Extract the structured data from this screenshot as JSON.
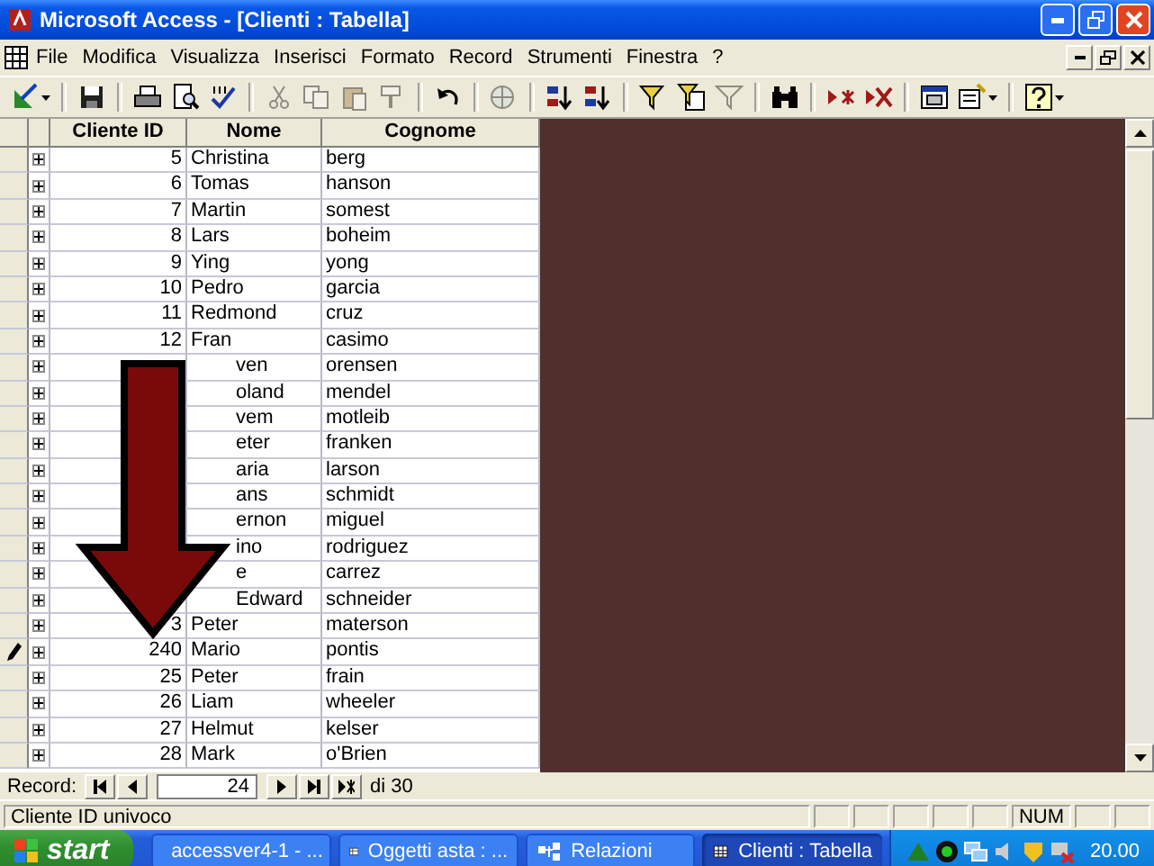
{
  "window": {
    "title": "Microsoft Access - [Clienti : Tabella]"
  },
  "menu": [
    "File",
    "Modifica",
    "Visualizza",
    "Inserisci",
    "Formato",
    "Record",
    "Strumenti",
    "Finestra",
    "?"
  ],
  "toolbar": [
    {
      "kind": "view",
      "disabled": false
    },
    {
      "kind": "separator"
    },
    {
      "kind": "save",
      "disabled": false
    },
    {
      "kind": "separator"
    },
    {
      "kind": "print",
      "disabled": false
    },
    {
      "kind": "preview",
      "disabled": false
    },
    {
      "kind": "spelling",
      "disabled": false
    },
    {
      "kind": "separator"
    },
    {
      "kind": "cut",
      "disabled": true
    },
    {
      "kind": "copy",
      "disabled": true
    },
    {
      "kind": "paste",
      "disabled": true
    },
    {
      "kind": "painter",
      "disabled": true
    },
    {
      "kind": "separator"
    },
    {
      "kind": "undo",
      "disabled": false
    },
    {
      "kind": "separator"
    },
    {
      "kind": "hyperlink",
      "disabled": true
    },
    {
      "kind": "separator"
    },
    {
      "kind": "sort_asc",
      "disabled": false
    },
    {
      "kind": "sort_desc",
      "disabled": false
    },
    {
      "kind": "separator"
    },
    {
      "kind": "filter_selection",
      "disabled": false
    },
    {
      "kind": "filter_form",
      "disabled": false
    },
    {
      "kind": "filter_apply",
      "disabled": true
    },
    {
      "kind": "separator"
    },
    {
      "kind": "find",
      "disabled": false
    },
    {
      "kind": "separator"
    },
    {
      "kind": "new_record",
      "disabled": false
    },
    {
      "kind": "delete_record",
      "disabled": false
    },
    {
      "kind": "separator"
    },
    {
      "kind": "database_window",
      "disabled": false
    },
    {
      "kind": "new_object",
      "disabled": false
    },
    {
      "kind": "separator"
    },
    {
      "kind": "help",
      "disabled": false
    }
  ],
  "table": {
    "columns": [
      "Cliente ID",
      "Nome",
      "Cognome"
    ],
    "rows": [
      {
        "id": "5",
        "nome": "Christina",
        "cognome": "berg",
        "editing": false,
        "partial": false
      },
      {
        "id": "6",
        "nome": "Tomas",
        "cognome": "hanson",
        "editing": false,
        "partial": false
      },
      {
        "id": "7",
        "nome": "Martin",
        "cognome": "somest",
        "editing": false,
        "partial": false
      },
      {
        "id": "8",
        "nome": "Lars",
        "cognome": "boheim",
        "editing": false,
        "partial": false
      },
      {
        "id": "9",
        "nome": "Ying",
        "cognome": "yong",
        "editing": false,
        "partial": false
      },
      {
        "id": "10",
        "nome": "Pedro",
        "cognome": "garcia",
        "editing": false,
        "partial": false
      },
      {
        "id": "11",
        "nome": "Redmond",
        "cognome": "cruz",
        "editing": false,
        "partial": false
      },
      {
        "id": "12",
        "nome": "Fran",
        "cognome": "casimo",
        "editing": false,
        "partial": false
      },
      {
        "nome": "ven",
        "cognome": "orensen",
        "editing": false,
        "partial": true
      },
      {
        "nome": "oland",
        "cognome": "mendel",
        "editing": false,
        "partial": true
      },
      {
        "nome": "vem",
        "cognome": "motleib",
        "editing": false,
        "partial": true
      },
      {
        "nome": "eter",
        "cognome": "franken",
        "editing": false,
        "partial": true
      },
      {
        "nome": "aria",
        "cognome": "larson",
        "editing": false,
        "partial": true
      },
      {
        "nome": "ans",
        "cognome": "schmidt",
        "editing": false,
        "partial": true
      },
      {
        "nome": "ernon",
        "cognome": "miguel",
        "editing": false,
        "partial": true
      },
      {
        "nome": "ino",
        "cognome": "rodriguez",
        "editing": false,
        "partial": true
      },
      {
        "nome": "e",
        "cognome": "carrez",
        "editing": false,
        "partial": true
      },
      {
        "nome": "Edward",
        "cognome": "schneider",
        "editing": false,
        "partial": true
      },
      {
        "id": "3",
        "nome": "Peter",
        "cognome": "materson",
        "editing": false,
        "partial": false
      },
      {
        "id": "240",
        "nome": "Mario",
        "cognome": "pontis",
        "editing": true,
        "partial": false
      },
      {
        "id": "25",
        "nome": "Peter",
        "cognome": "frain",
        "editing": false,
        "partial": false
      },
      {
        "id": "26",
        "nome": "Liam",
        "cognome": "wheeler",
        "editing": false,
        "partial": false
      },
      {
        "id": "27",
        "nome": "Helmut",
        "cognome": "kelser",
        "editing": false,
        "partial": false
      },
      {
        "id": "28",
        "nome": "Mark",
        "cognome": "o'Brien",
        "editing": false,
        "partial": false
      }
    ]
  },
  "record_nav": {
    "label": "Record:",
    "current": "24",
    "total": "di 30"
  },
  "status_bar": {
    "text": "Cliente ID univoco",
    "indicators": [
      "NUM"
    ]
  },
  "taskbar": {
    "start": "start",
    "tasks": [
      {
        "kind": "document",
        "label": "accessver4-1 - ...",
        "selected": false
      },
      {
        "kind": "database",
        "label": "Oggetti asta : ...",
        "selected": false
      },
      {
        "kind": "relations",
        "label": "Relazioni",
        "selected": false
      },
      {
        "kind": "table",
        "label": "Clienti : Tabella",
        "selected": true
      }
    ],
    "clock": "20.00"
  }
}
